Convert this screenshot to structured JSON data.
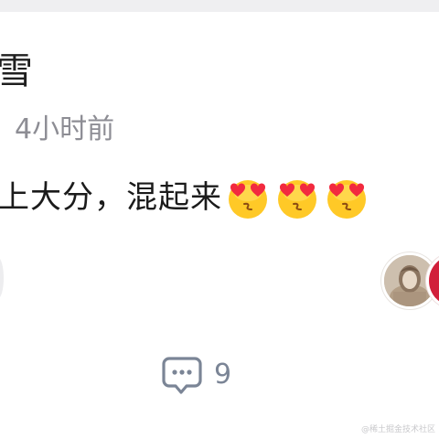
{
  "post": {
    "author_name": "雪",
    "time": "4小时前",
    "text": "上大分，混起来",
    "emojis": [
      "heart-eyes-emoji",
      "heart-eyes-emoji",
      "heart-eyes-emoji"
    ]
  },
  "engagement": {
    "comment_count": "9"
  },
  "watermark": {
    "text": "@稀土掘金技术社区"
  },
  "colors": {
    "name_text": "#1f1f1f",
    "time_text": "#8d8d94",
    "comment_icon": "#7b8596",
    "avatar_red": "#d11f3a",
    "emoji_face": "#ffc927",
    "emoji_heart": "#f22a3f"
  }
}
